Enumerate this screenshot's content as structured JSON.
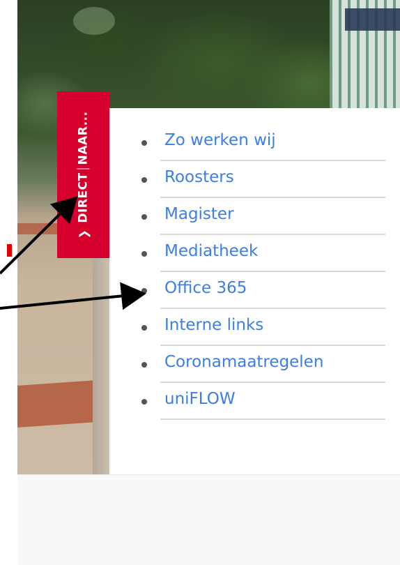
{
  "side_tab": {
    "label_part1": "DIRECT",
    "label_part2": "NAAR...",
    "chevron": "chevron-up-icon"
  },
  "menu": {
    "items": [
      {
        "label": "Zo werken wij"
      },
      {
        "label": "Roosters"
      },
      {
        "label": "Magister"
      },
      {
        "label": "Mediatheek"
      },
      {
        "label": "Office 365"
      },
      {
        "label": "Interne links"
      },
      {
        "label": "Coronamaatregelen"
      },
      {
        "label": "uniFLOW"
      }
    ]
  },
  "colors": {
    "tab": "#d6002d",
    "link": "#3a7ee6",
    "annotation_arrows": "#000000"
  }
}
